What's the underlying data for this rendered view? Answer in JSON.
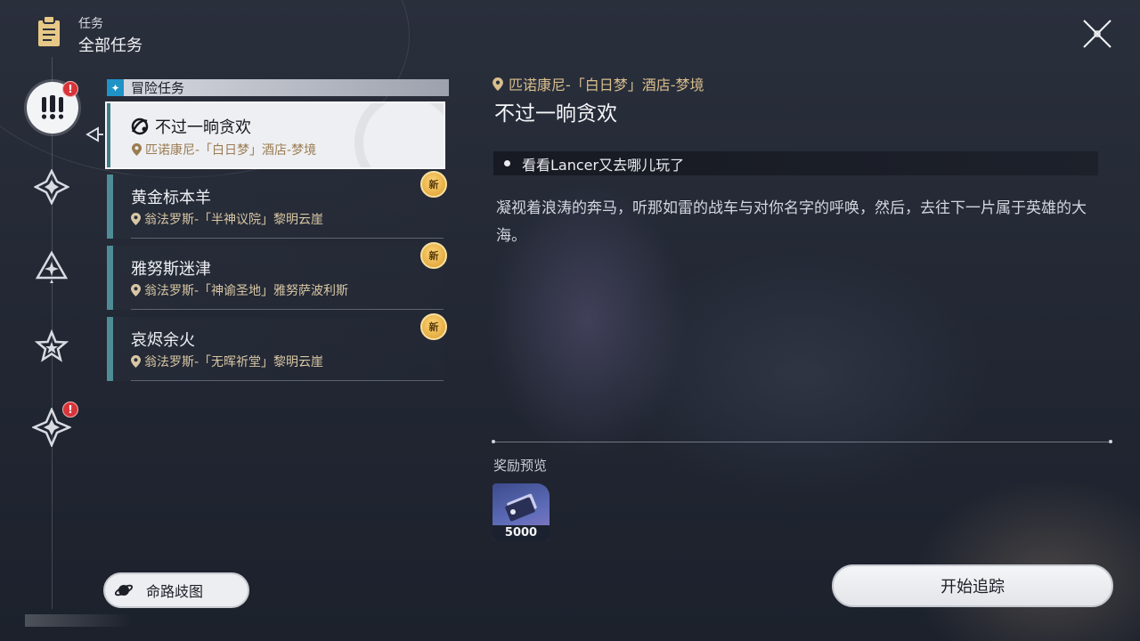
{
  "header": {
    "subtitle": "任务",
    "title": "全部任务",
    "icon": "clipboard-icon"
  },
  "close": {
    "icon": "close-icon"
  },
  "categories": [
    {
      "icon": "exclamation-icon",
      "active": true,
      "alert": "!"
    },
    {
      "icon": "diamond-star-icon",
      "active": false
    },
    {
      "icon": "triangle-star-icon",
      "active": false
    },
    {
      "icon": "star-badge-icon",
      "active": false
    },
    {
      "icon": "compass-star-icon",
      "active": false,
      "alert": "!"
    }
  ],
  "category_header": {
    "label": "冒险任务",
    "icon": "sparkle-icon"
  },
  "quests": [
    {
      "name": "不过一晌贪欢",
      "location": "匹诺康尼-「白日梦」酒店-梦境",
      "selected": true
    },
    {
      "name": "黄金标本羊",
      "location": "翁法罗斯-「半神议院」黎明云崖",
      "badge": "新"
    },
    {
      "name": "雅努斯迷津",
      "location": "翁法罗斯-「神谕圣地」雅努萨波利斯",
      "badge": "新"
    },
    {
      "name": "哀烬余火",
      "location": "翁法罗斯-「无晖祈堂」黎明云崖",
      "badge": "新"
    }
  ],
  "route_button": {
    "label": "命路歧图",
    "icon": "planet-icon"
  },
  "detail": {
    "location": "匹诺康尼-「白日梦」酒店-梦境",
    "title": "不过一晌贪欢",
    "objective": "看看Lancer又去哪儿玩了",
    "description": "凝视着浪涛的奔马，听那如雷的战车与对你名字的呼唤，然后，去往下一片属于英雄的大海。",
    "reward_label": "奖励预览",
    "rewards": [
      {
        "icon": "credit-card-icon",
        "quantity": "5000"
      }
    ],
    "track_button": "开始追踪"
  },
  "colors": {
    "accent_teal": "#4f8d96",
    "gold": "#d9bf8c",
    "alert": "#d7353a",
    "badge": "#e2a83a"
  }
}
